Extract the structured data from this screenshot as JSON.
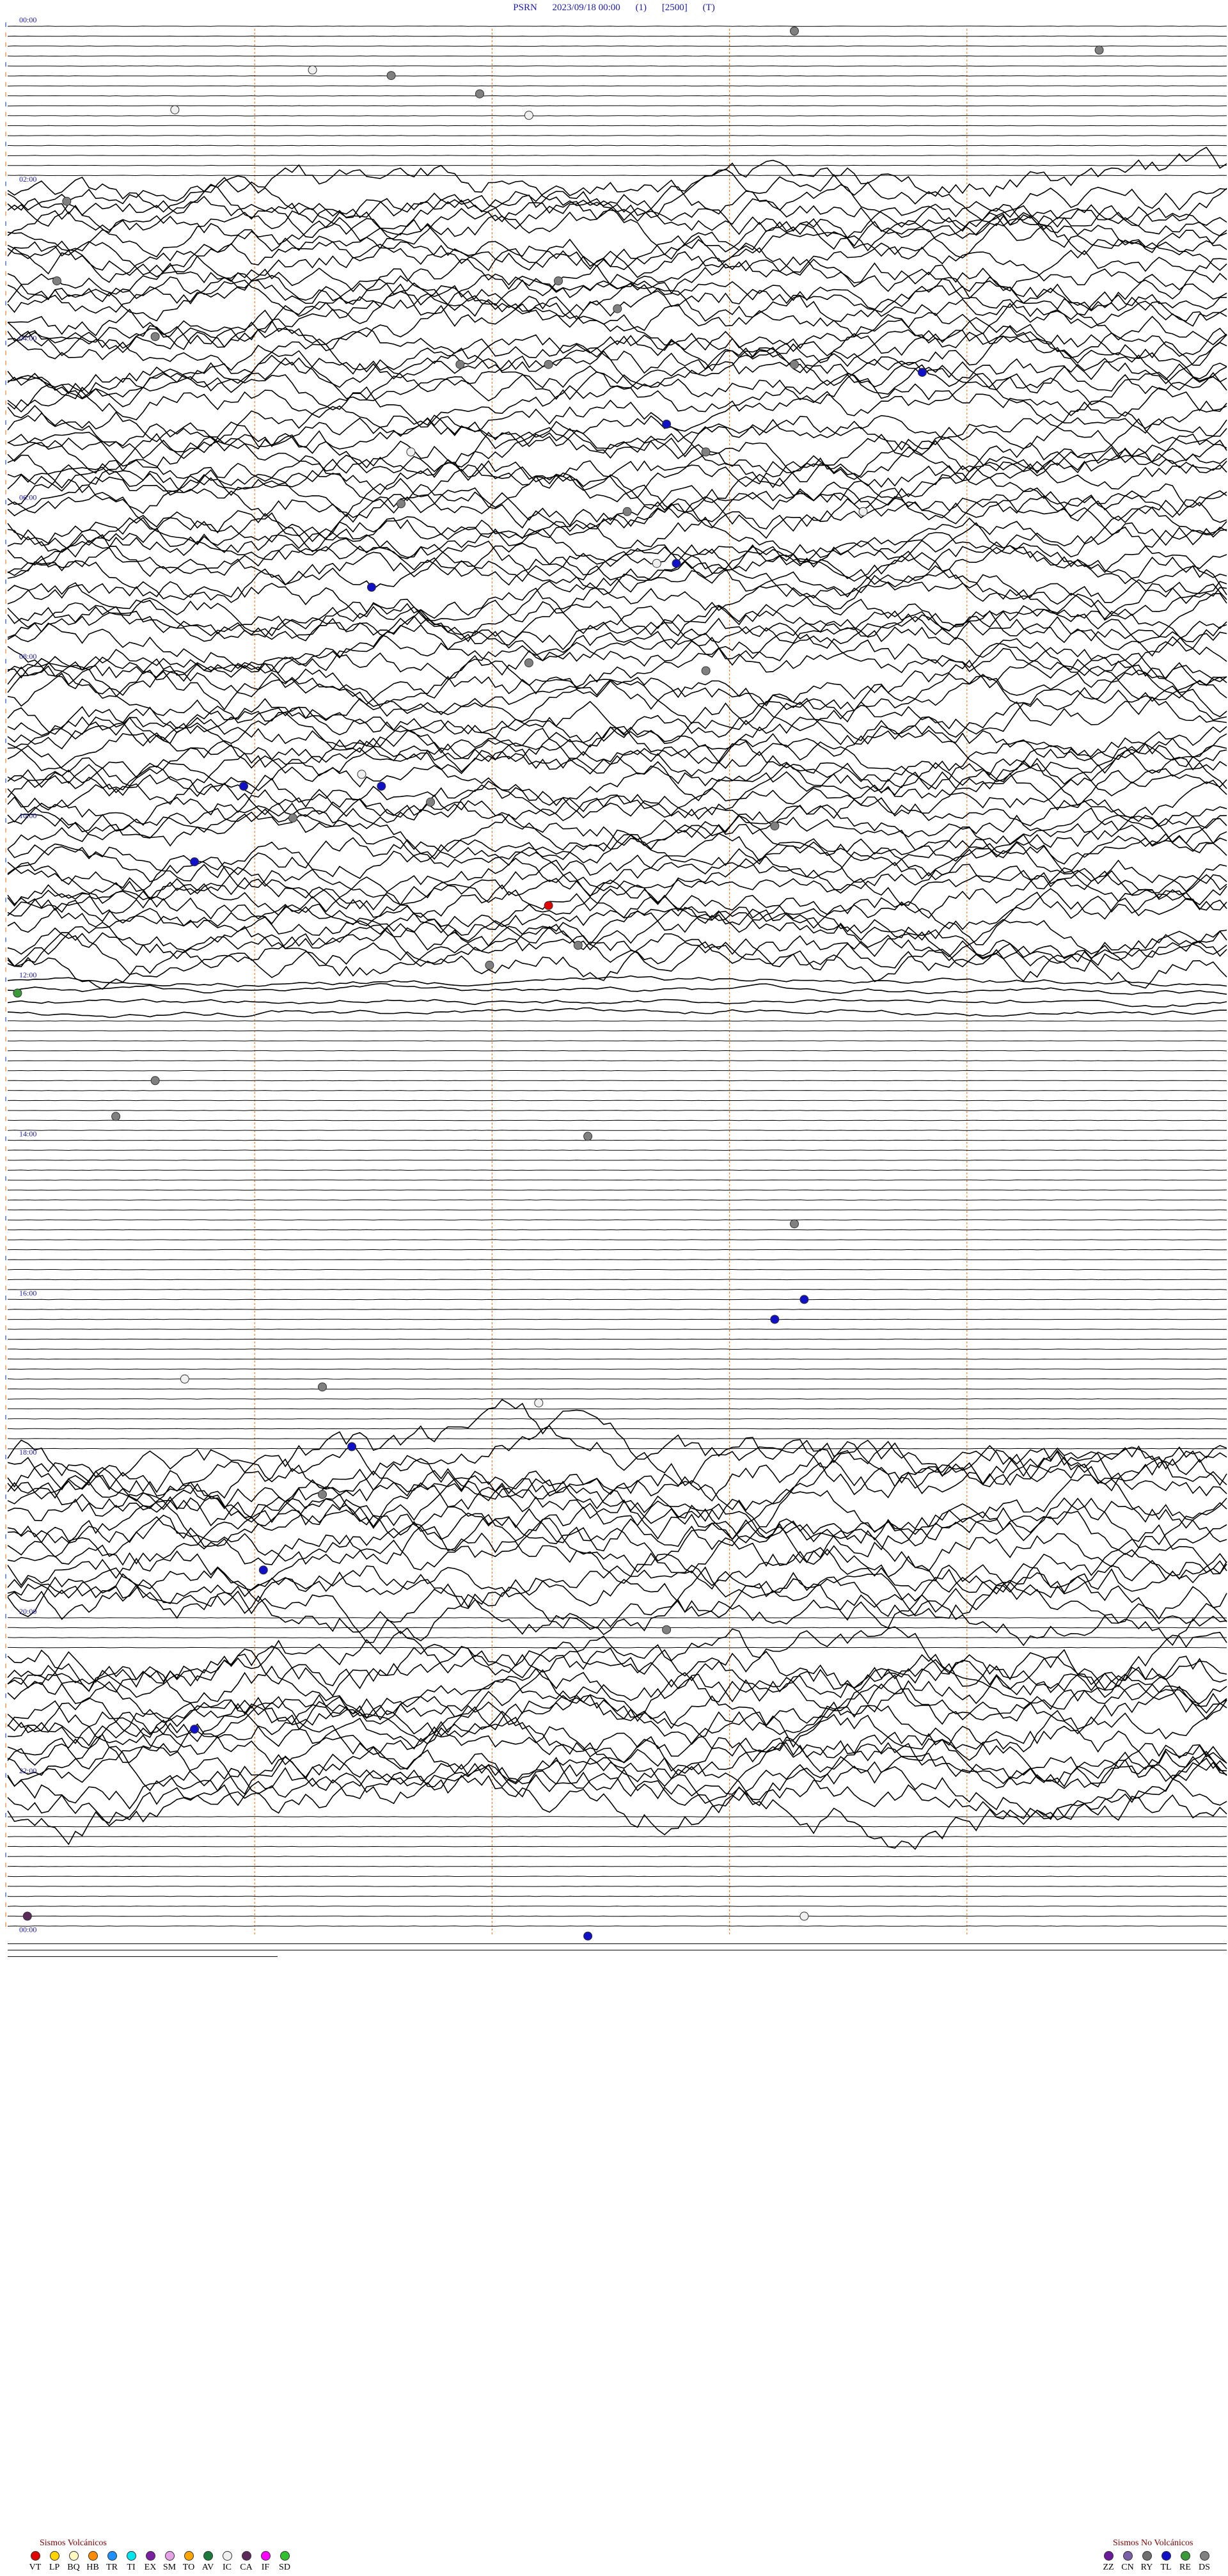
{
  "header": {
    "station": "PSRN",
    "datetime": "2023/09/18 00:00",
    "channel": "(1)",
    "scale": "[2500]",
    "mode": "(T)"
  },
  "chart_data": {
    "type": "line",
    "description_type": "helicorder",
    "hour_labels": [
      "00:00",
      "02:00",
      "04:00",
      "06:00",
      "08:00",
      "10:00",
      "12:00",
      "14:00",
      "16:00",
      "18:00",
      "20:00",
      "22:00",
      "00:00"
    ],
    "lines_per_hour": 8,
    "minutes_per_line": 15,
    "noise_bursts": [
      {
        "from_hour": 2.0,
        "to_hour": 12.0,
        "level": "moderate"
      },
      {
        "from_hour": 12.0,
        "to_hour": 12.5,
        "level": "strong"
      },
      {
        "from_hour": 18.0,
        "to_hour": 20.0,
        "level": "high"
      },
      {
        "from_hour": 20.5,
        "to_hour": 22.5,
        "level": "high"
      }
    ],
    "events": [
      {
        "hour": 0.06,
        "minute_of_line": 8.0,
        "type": "DS"
      },
      {
        "hour": 0.3,
        "minute_of_line": 11.1,
        "type": "DS"
      },
      {
        "hour": 0.55,
        "minute_of_line": 3.1,
        "type": "IC"
      },
      {
        "hour": 0.62,
        "minute_of_line": 3.9,
        "type": "DS"
      },
      {
        "hour": 0.85,
        "minute_of_line": 4.8,
        "type": "DS"
      },
      {
        "hour": 1.05,
        "minute_of_line": 1.7,
        "type": "IC"
      },
      {
        "hour": 1.12,
        "minute_of_line": 5.3,
        "type": "IC"
      },
      {
        "hour": 2.2,
        "minute_of_line": 0.6,
        "type": "DS"
      },
      {
        "hour": 3.2,
        "minute_of_line": 0.5,
        "type": "DS"
      },
      {
        "hour": 3.2,
        "minute_of_line": 5.6,
        "type": "DS"
      },
      {
        "hour": 3.55,
        "minute_of_line": 6.2,
        "type": "DS"
      },
      {
        "hour": 3.9,
        "minute_of_line": 1.5,
        "type": "DS"
      },
      {
        "hour": 4.25,
        "minute_of_line": 4.6,
        "type": "DS"
      },
      {
        "hour": 4.25,
        "minute_of_line": 5.5,
        "type": "DS"
      },
      {
        "hour": 4.25,
        "minute_of_line": 8.0,
        "type": "DS"
      },
      {
        "hour": 4.35,
        "minute_of_line": 9.3,
        "type": "TL"
      },
      {
        "hour": 5.0,
        "minute_of_line": 6.7,
        "type": "TL"
      },
      {
        "hour": 5.35,
        "minute_of_line": 4.1,
        "type": "IC"
      },
      {
        "hour": 5.35,
        "minute_of_line": 7.1,
        "type": "DS"
      },
      {
        "hour": 6.0,
        "minute_of_line": 4.0,
        "type": "DS"
      },
      {
        "hour": 6.1,
        "minute_of_line": 6.3,
        "type": "DS"
      },
      {
        "hour": 6.1,
        "minute_of_line": 8.7,
        "type": "IC"
      },
      {
        "hour": 6.75,
        "minute_of_line": 6.6,
        "type": "IC"
      },
      {
        "hour": 6.75,
        "minute_of_line": 6.8,
        "type": "TL"
      },
      {
        "hour": 7.05,
        "minute_of_line": 3.7,
        "type": "TL"
      },
      {
        "hour": 8.0,
        "minute_of_line": 5.3,
        "type": "DS"
      },
      {
        "hour": 8.1,
        "minute_of_line": 7.1,
        "type": "DS"
      },
      {
        "hour": 9.4,
        "minute_of_line": 3.6,
        "type": "IC"
      },
      {
        "hour": 9.55,
        "minute_of_line": 2.4,
        "type": "TL"
      },
      {
        "hour": 9.55,
        "minute_of_line": 3.8,
        "type": "TL"
      },
      {
        "hour": 9.75,
        "minute_of_line": 4.3,
        "type": "DS"
      },
      {
        "hour": 9.95,
        "minute_of_line": 2.9,
        "type": "DS"
      },
      {
        "hour": 10.05,
        "minute_of_line": 7.8,
        "type": "DS"
      },
      {
        "hour": 10.5,
        "minute_of_line": 1.9,
        "type": "TL"
      },
      {
        "hour": 11.05,
        "minute_of_line": 5.5,
        "type": "VT"
      },
      {
        "hour": 11.55,
        "minute_of_line": 5.8,
        "type": "DS"
      },
      {
        "hour": 11.8,
        "minute_of_line": 4.9,
        "type": "DS"
      },
      {
        "hour": 12.15,
        "minute_of_line": 0.1,
        "type": "RE"
      },
      {
        "hour": 13.25,
        "minute_of_line": 1.5,
        "type": "DS"
      },
      {
        "hour": 13.7,
        "minute_of_line": 1.1,
        "type": "DS"
      },
      {
        "hour": 13.95,
        "minute_of_line": 5.9,
        "type": "DS"
      },
      {
        "hour": 15.05,
        "minute_of_line": 8.0,
        "type": "DS"
      },
      {
        "hour": 16.0,
        "minute_of_line": 8.1,
        "type": "TL"
      },
      {
        "hour": 16.25,
        "minute_of_line": 7.8,
        "type": "TL"
      },
      {
        "hour": 17.0,
        "minute_of_line": 1.8,
        "type": "IC"
      },
      {
        "hour": 17.1,
        "minute_of_line": 3.2,
        "type": "DS"
      },
      {
        "hour": 17.3,
        "minute_of_line": 5.4,
        "type": "IC"
      },
      {
        "hour": 17.85,
        "minute_of_line": 3.5,
        "type": "TL"
      },
      {
        "hour": 18.45,
        "minute_of_line": 3.2,
        "type": "DS"
      },
      {
        "hour": 19.4,
        "minute_of_line": 2.6,
        "type": "TL"
      },
      {
        "hour": 20.15,
        "minute_of_line": 6.7,
        "type": "DS"
      },
      {
        "hour": 21.4,
        "minute_of_line": 1.9,
        "type": "TL"
      },
      {
        "hour": 23.75,
        "minute_of_line": 0.2,
        "type": "CA"
      },
      {
        "hour": 23.75,
        "minute_of_line": 8.1,
        "type": "IC"
      },
      {
        "hour": 24.0,
        "minute_of_line": 5.9,
        "type": "TL"
      }
    ]
  },
  "legend_volcanic": {
    "title": "Sismos Volcánicos",
    "items": [
      {
        "code": "VT",
        "color": "#e00000"
      },
      {
        "code": "LP",
        "color": "#ffd400"
      },
      {
        "code": "BQ",
        "color": "#fff9c0"
      },
      {
        "code": "HB",
        "color": "#ff8c00"
      },
      {
        "code": "TR",
        "color": "#1e90ff"
      },
      {
        "code": "TI",
        "color": "#00e5ee"
      },
      {
        "code": "EX",
        "color": "#7b1fa2"
      },
      {
        "code": "SM",
        "color": "#e6a0e6"
      },
      {
        "code": "TO",
        "color": "#ffa500"
      },
      {
        "code": "AV",
        "color": "#1b7a3a"
      },
      {
        "code": "IC",
        "color": "#f0f0f0"
      },
      {
        "code": "CA",
        "color": "#5a2a5a"
      },
      {
        "code": "IF",
        "color": "#ff00ff"
      },
      {
        "code": "SD",
        "color": "#2fbf2f"
      }
    ]
  },
  "legend_nonvolcanic": {
    "title": "Sismos No Volcánicos",
    "items": [
      {
        "code": "ZZ",
        "color": "#6a1b9a"
      },
      {
        "code": "CN",
        "color": "#7a5ea8"
      },
      {
        "code": "RY",
        "color": "#6f6f6f"
      },
      {
        "code": "TL",
        "color": "#1010c8"
      },
      {
        "code": "RE",
        "color": "#3a9a3a"
      },
      {
        "code": "DS",
        "color": "#808080"
      }
    ]
  }
}
